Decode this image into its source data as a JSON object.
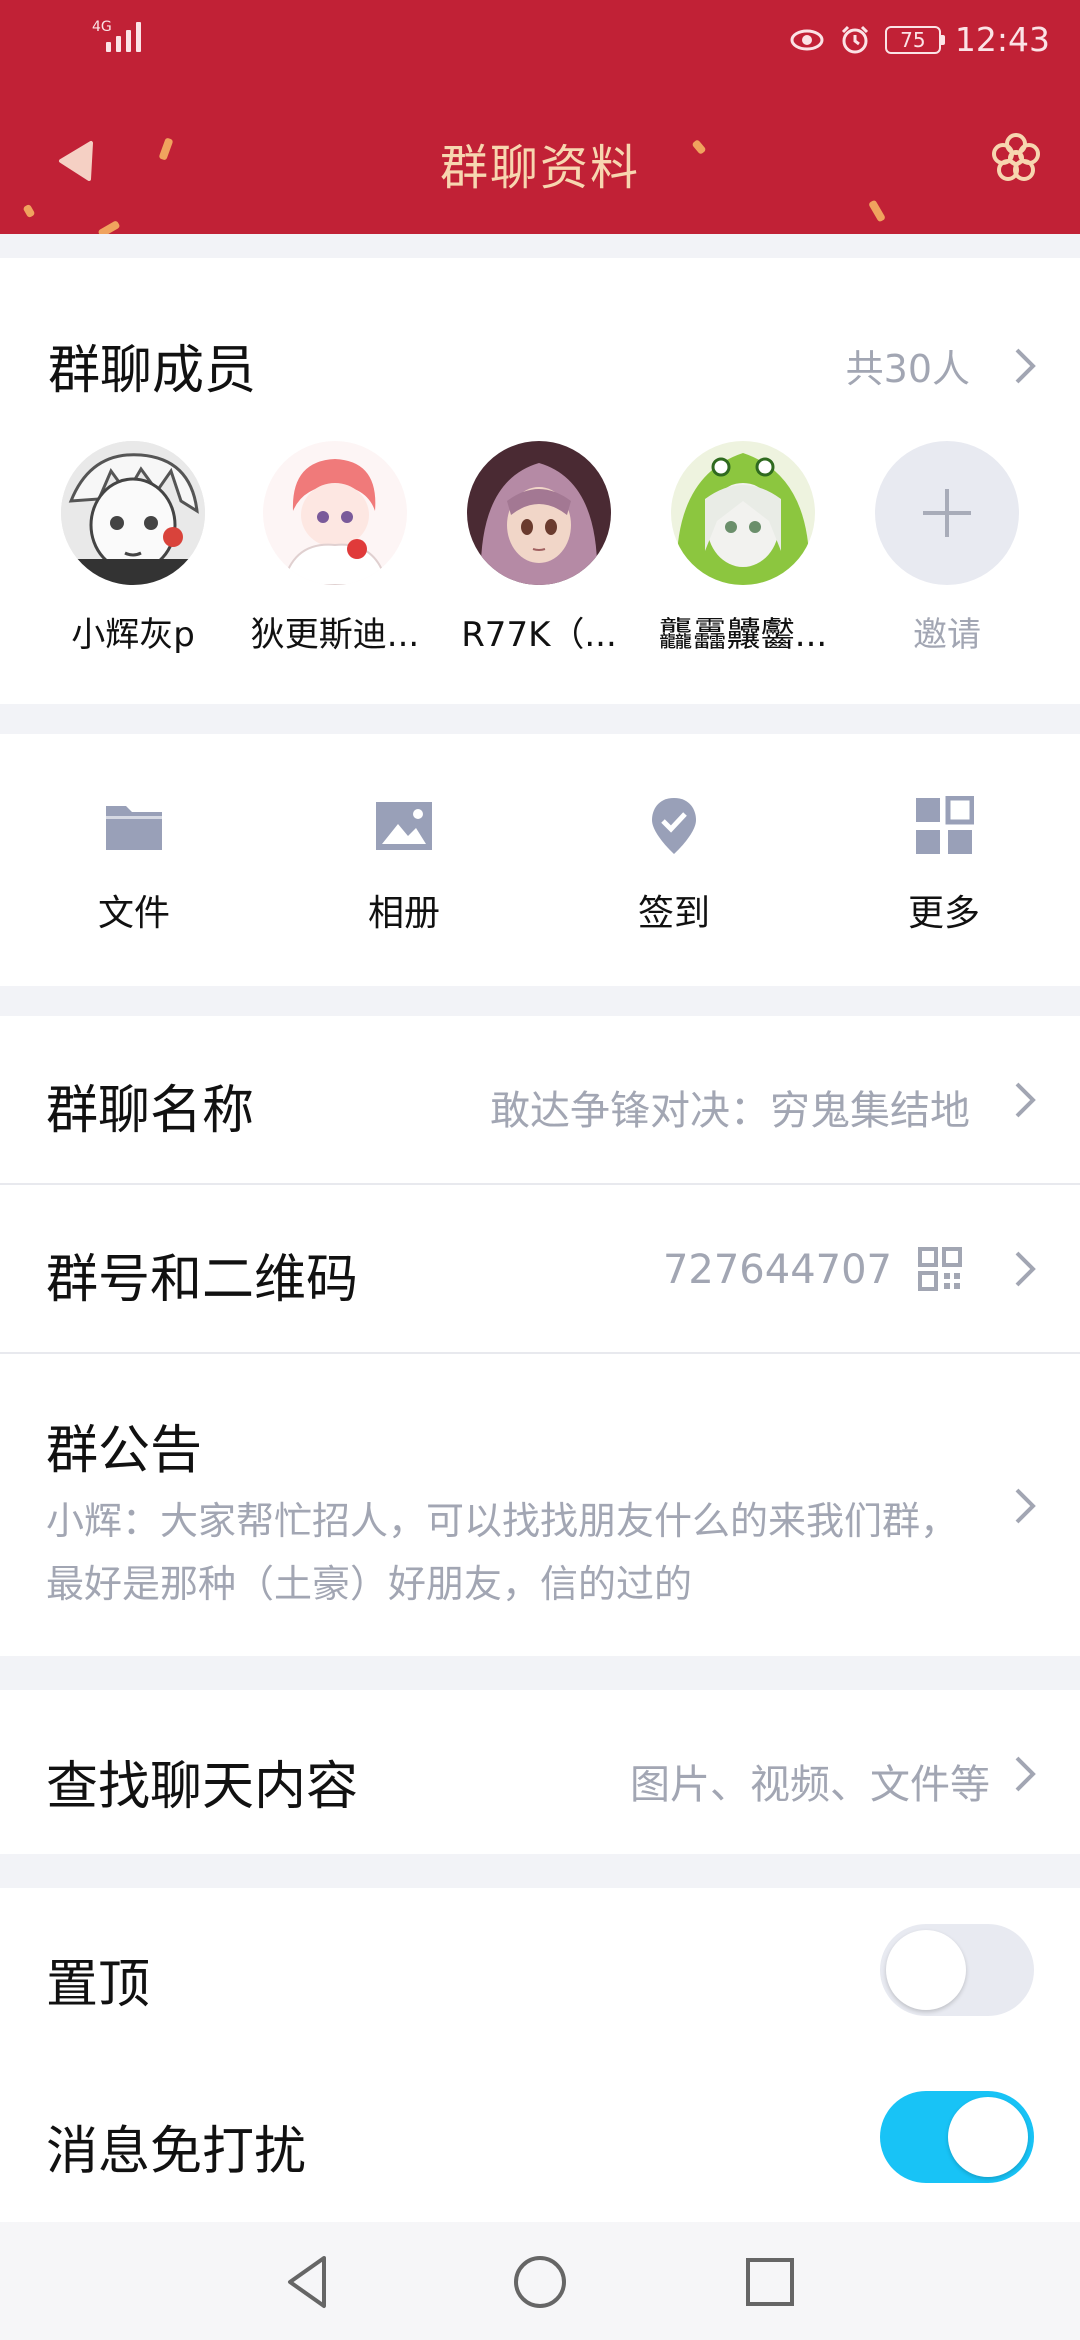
{
  "status_bar": {
    "network": "4G",
    "battery": "75",
    "time": "12:43"
  },
  "header": {
    "title": "群聊资料",
    "back_icon": "back-arrow-icon",
    "menu_icon": "flower-icon",
    "color": "#c12136"
  },
  "members": {
    "title": "群聊成员",
    "count": "共30人",
    "list": [
      {
        "name": "小辉灰p"
      },
      {
        "name": "狄更斯迪..."
      },
      {
        "name": "R77K（..."
      },
      {
        "name": "龘靐齉齾..."
      }
    ],
    "invite_label": "邀请"
  },
  "tools": [
    {
      "label": "文件",
      "icon": "folder-icon"
    },
    {
      "label": "相册",
      "icon": "image-icon"
    },
    {
      "label": "签到",
      "icon": "location-check-icon"
    },
    {
      "label": "更多",
      "icon": "grid-icon"
    }
  ],
  "info": {
    "group_name_label": "群聊名称",
    "group_name_value": "敢达争锋对决：穷鬼集结地",
    "group_id_label": "群号和二维码",
    "group_id_value": "727644707",
    "notice_label": "群公告",
    "notice_text": "小辉：大家帮忙招人，可以找找朋友什么的来我们群，最好是那种（土豪）好朋友，信的过的"
  },
  "search": {
    "label": "查找聊天内容",
    "hint": "图片、视频、文件等"
  },
  "settings": {
    "pin_label": "置顶",
    "pin_on": false,
    "mute_label": "消息免打扰",
    "mute_on": true
  }
}
